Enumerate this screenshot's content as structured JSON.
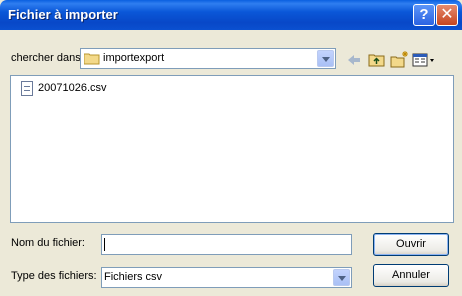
{
  "window": {
    "title": "Fichier à importer"
  },
  "lookin": {
    "label": "chercher dans:",
    "value": "importexport"
  },
  "toolbar": {
    "back_icon": "back-arrow-icon",
    "up_icon": "up-folder-icon",
    "new_folder_icon": "new-folder-icon",
    "view_icon": "view-menu-icon"
  },
  "files": [
    {
      "name": "20071026.csv",
      "icon": "csv-file-icon"
    }
  ],
  "filename": {
    "label": "Nom du fichier:",
    "value": ""
  },
  "filetype": {
    "label": "Type des fichiers:",
    "value": "Fichiers csv"
  },
  "buttons": {
    "open": "Ouvrir",
    "cancel": "Annuler"
  }
}
